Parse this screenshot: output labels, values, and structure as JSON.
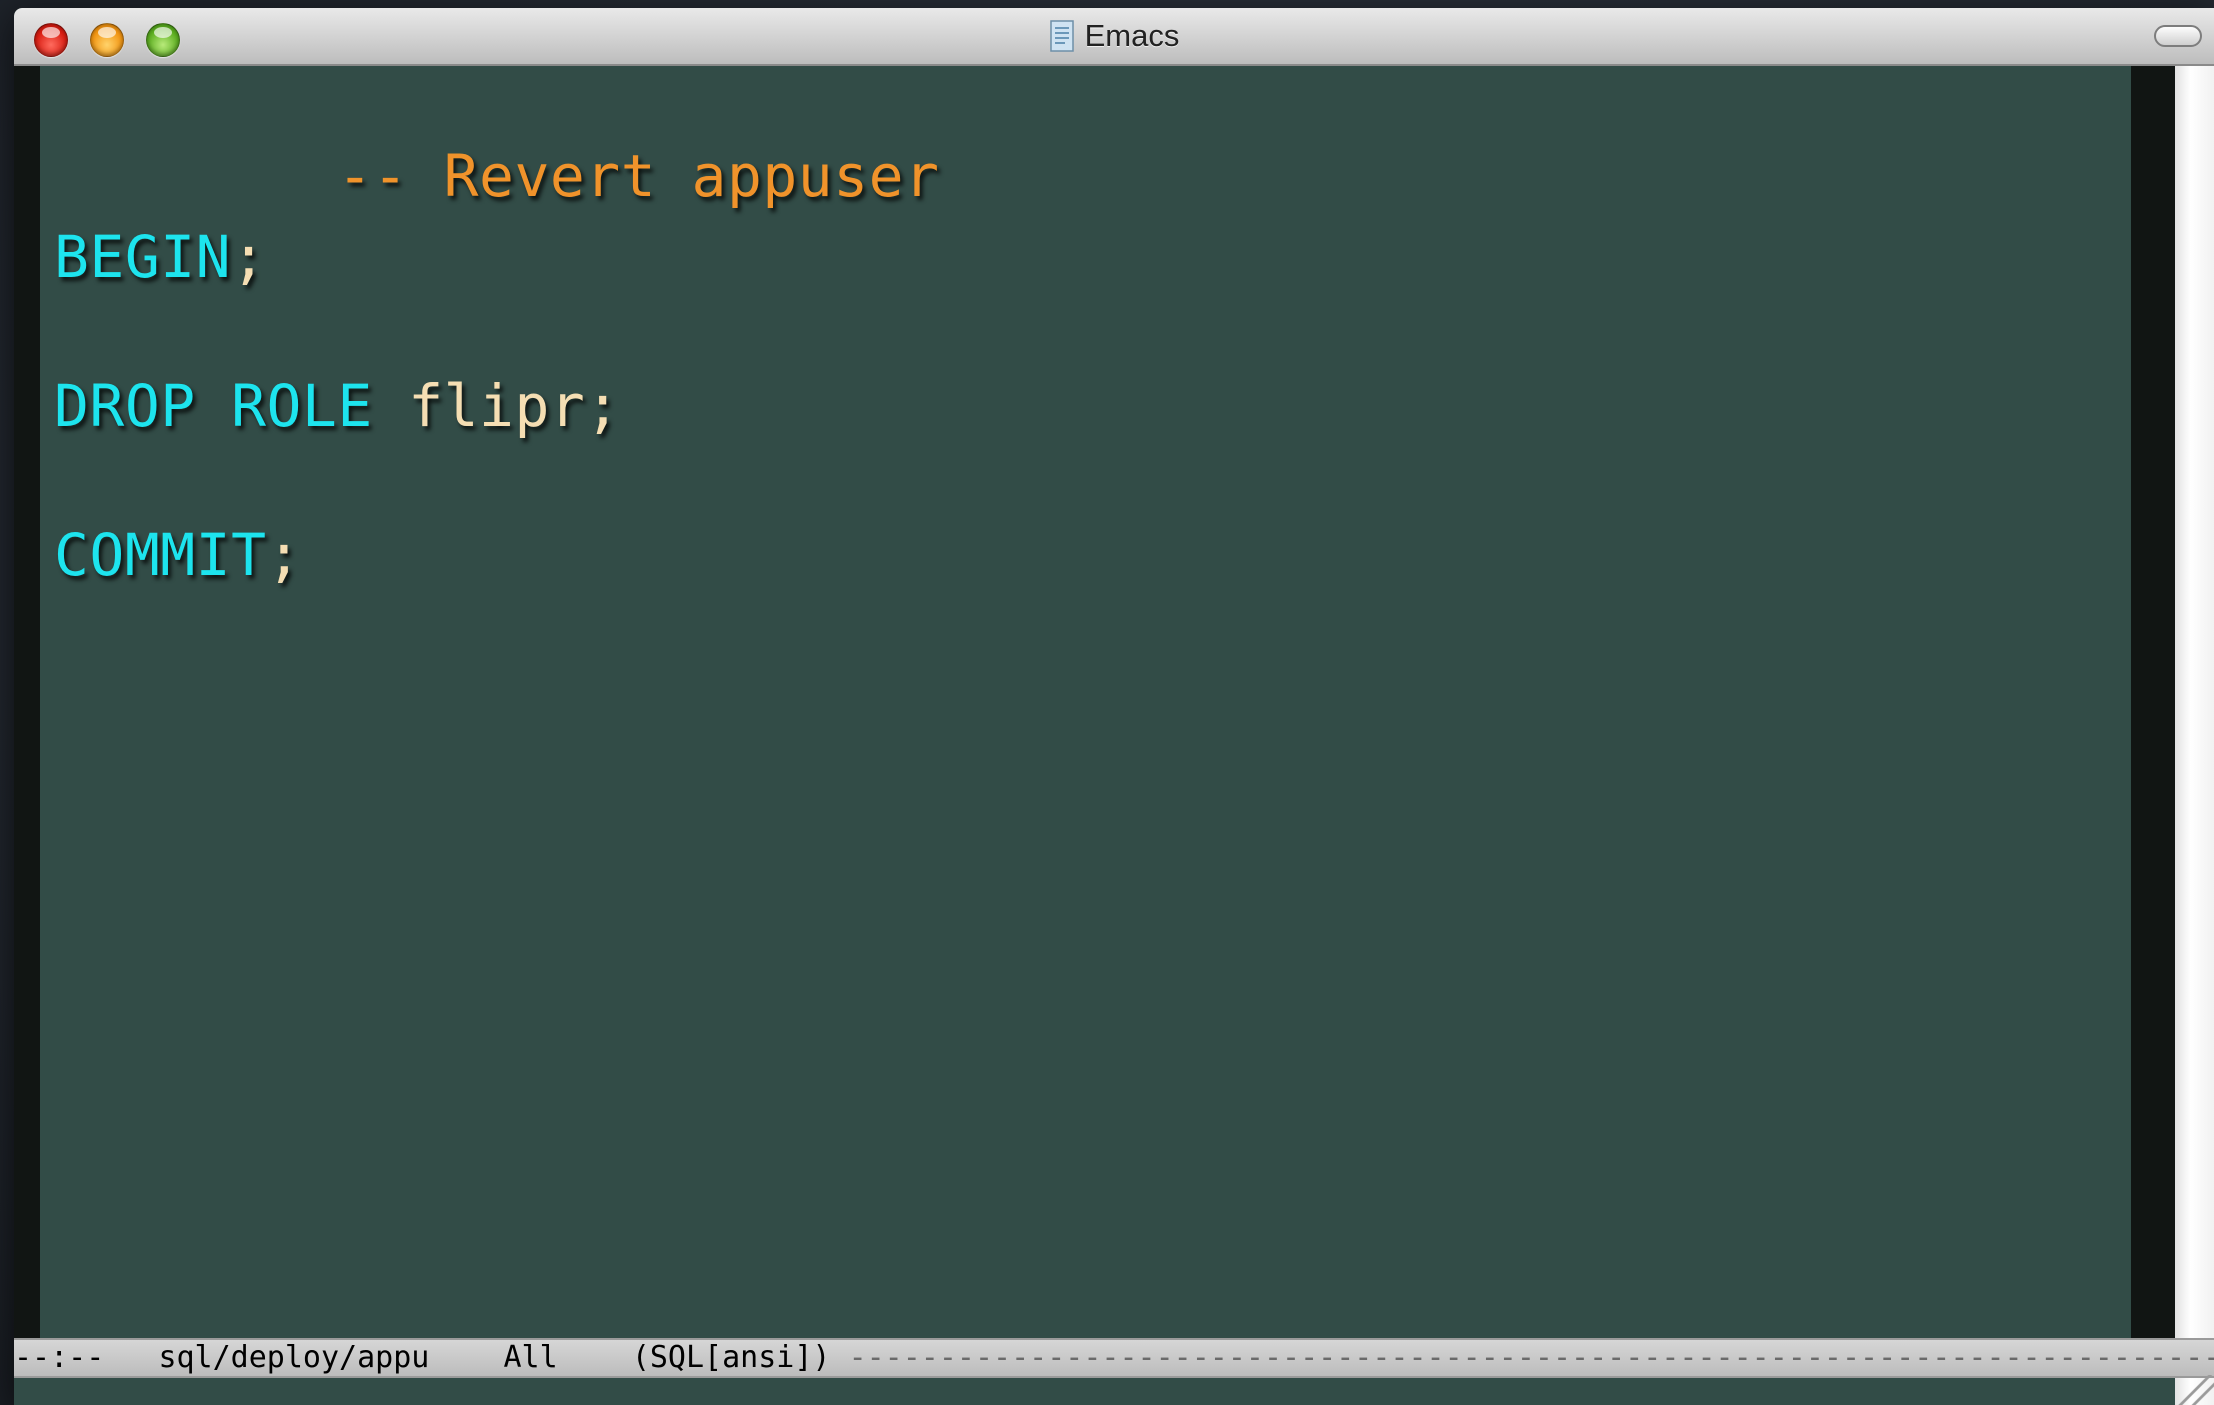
{
  "window": {
    "title": "Emacs",
    "title_icon": "document-icon"
  },
  "colors": {
    "editor_background": "#324c47",
    "comment": "#f0932b",
    "keyword": "#1de4ee",
    "identifier": "#f5deb3"
  },
  "buffer": {
    "lines": [
      {
        "comment": "-- Revert appuser"
      },
      {
        "keyword": "BEGIN",
        "rest": ";"
      },
      {
        "keyword": "DROP ROLE",
        "rest": " flipr;"
      },
      {
        "keyword": "COMMIT",
        "rest": ";"
      }
    ]
  },
  "modeline": {
    "status": "--:--",
    "buffer_name": "sql/deploy/appu",
    "position": "All",
    "mode": "(SQL[ansi])"
  }
}
